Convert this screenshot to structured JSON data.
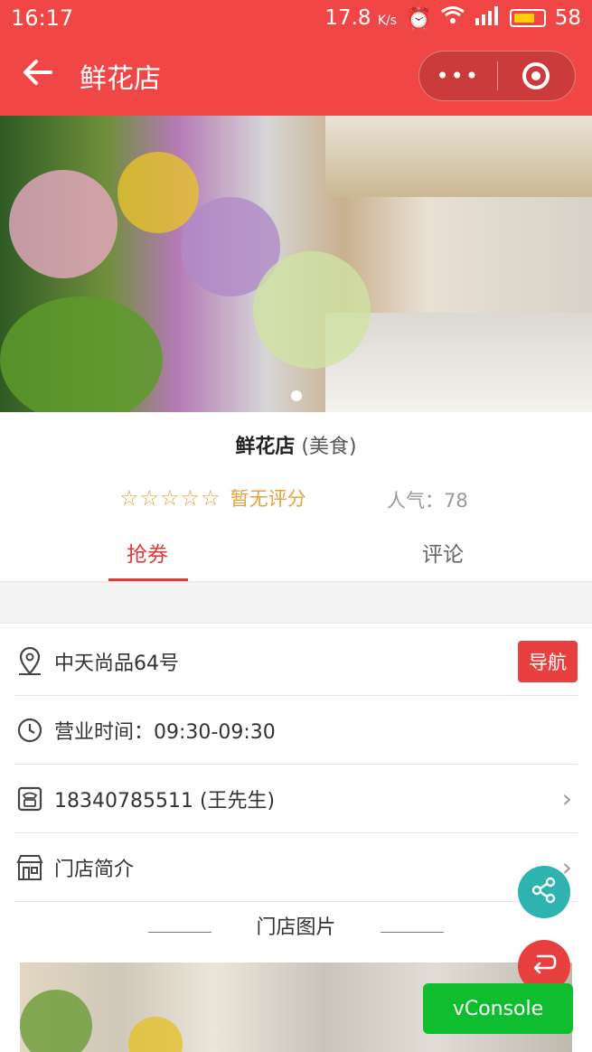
{
  "status_bar": {
    "time": "16:17",
    "speed": "17.8",
    "speed_unit": "K/s",
    "battery": "58"
  },
  "header": {
    "title": "鲜花店",
    "more_icon": "more-icon",
    "close_icon": "target-icon"
  },
  "banner": {
    "image": "flower-shop-photo",
    "current_slide": 1,
    "slides": 1
  },
  "shop": {
    "name": "鲜花店",
    "category": "(美食)",
    "stars": "☆☆☆☆☆",
    "rating_text": "暂无评分",
    "popularity": "人气：78"
  },
  "tabs": [
    {
      "label": "抢券",
      "active": true
    },
    {
      "label": "评论",
      "active": false
    }
  ],
  "details": {
    "address": "中天尚品64号",
    "nav_button": "导航",
    "hours": "营业时间：09:30-09:30",
    "phone": "18340785511 (王先生)",
    "intro": "门店简介",
    "section_title": "门店图片"
  },
  "floating": {
    "share_icon": "share-icon",
    "return_icon": "return-icon",
    "vconsole": "vConsole"
  },
  "colors": {
    "primary": "#f04646",
    "accent": "#e03b3b",
    "star": "#e8a13a",
    "share": "#2fb3b0",
    "vconsole": "#0fbe2e"
  }
}
